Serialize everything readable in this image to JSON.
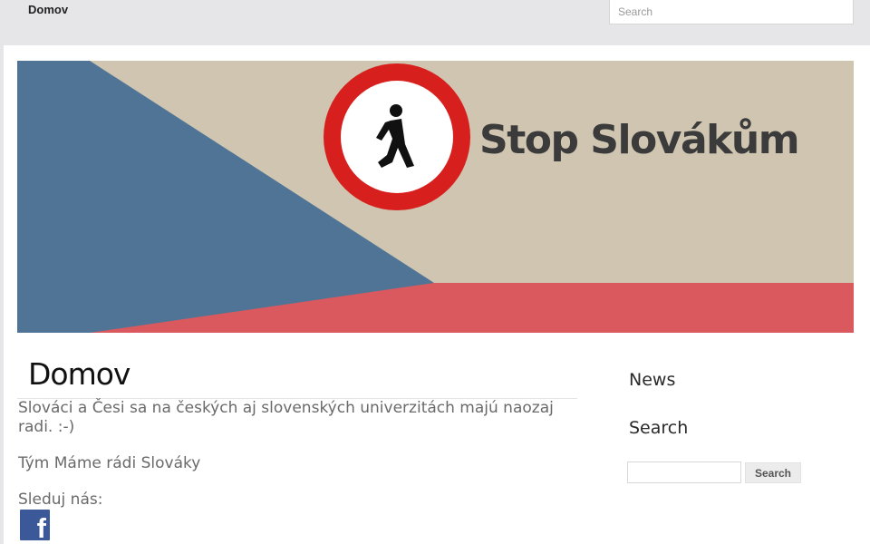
{
  "nav": {
    "home_label": "Domov"
  },
  "top_search": {
    "placeholder": "Search"
  },
  "banner": {
    "text": "Stop Slovákům"
  },
  "entry": {
    "title": "Domov",
    "paragraph1_line1": "Slováci a Česi sa na českých aj slovenských univerzitách majú naozaj",
    "paragraph1_line2": "radi. :-)",
    "team": "Tým Máme rádi Slováky",
    "follow": "Sleduj nás:",
    "facebook_icon_glyph": "f"
  },
  "sidebar": {
    "news_title": "News",
    "search_title": "Search",
    "search_button": "Search"
  },
  "colors": {
    "flag_blue": "#4f7495",
    "flag_red": "#d9595f",
    "sign_red": "#d7201d",
    "facebook_blue": "#3b5998"
  }
}
